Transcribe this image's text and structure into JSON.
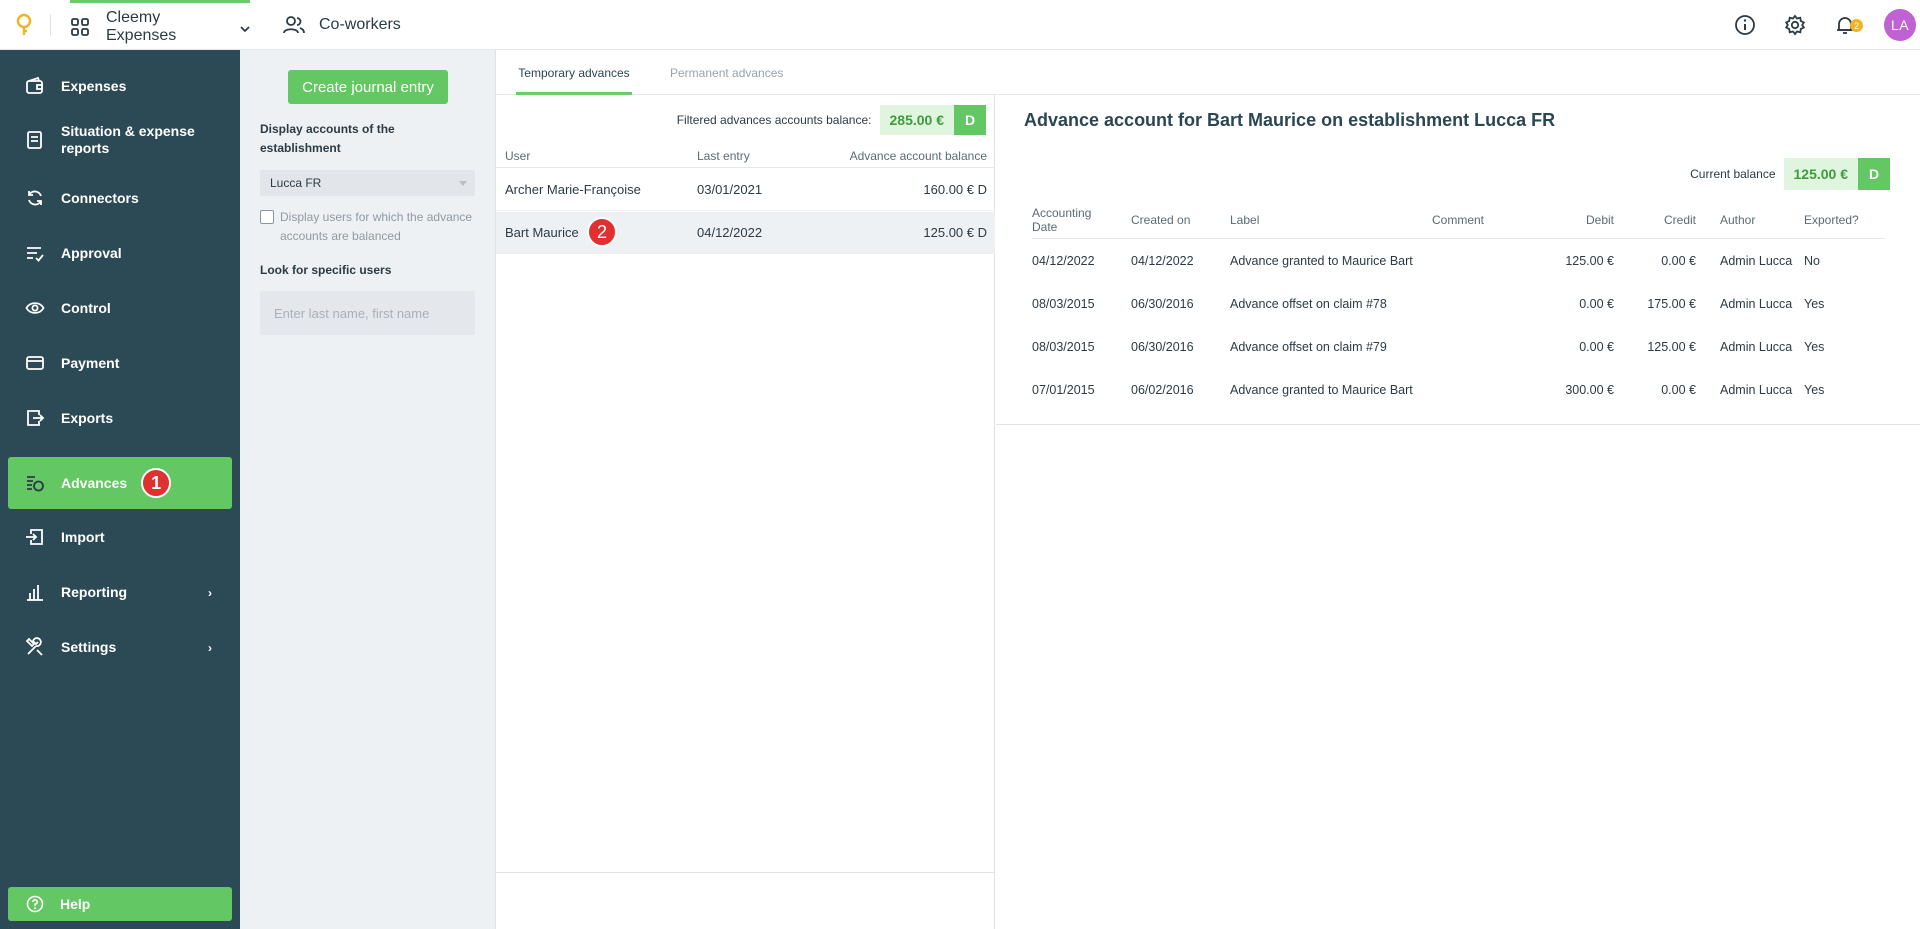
{
  "topbar": {
    "app_name": "Cleemy Expenses",
    "coworkers_label": "Co-workers",
    "notification_count": "2",
    "avatar_initials": "LA"
  },
  "sidebar": {
    "items": [
      {
        "label": "Expenses",
        "icon": "wallet-icon"
      },
      {
        "label": "Situation & expense reports",
        "icon": "document-icon"
      },
      {
        "label": "Connectors",
        "icon": "sync-icon"
      },
      {
        "label": "Approval",
        "icon": "checklist-icon"
      },
      {
        "label": "Control",
        "icon": "eye-icon"
      },
      {
        "label": "Payment",
        "icon": "card-icon"
      },
      {
        "label": "Exports",
        "icon": "export-icon"
      },
      {
        "label": "Advances",
        "icon": "coins-icon"
      },
      {
        "label": "Import",
        "icon": "import-icon"
      },
      {
        "label": "Reporting",
        "icon": "bar-chart-icon"
      },
      {
        "label": "Settings",
        "icon": "tools-icon"
      }
    ],
    "active_item": "Advances",
    "help_label": "Help",
    "marker_1": "1"
  },
  "filters": {
    "create_button": "Create journal entry",
    "establishment_label": "Display accounts of the establishment",
    "establishment_value": "Lucca FR",
    "balanced_checkbox_label": "Display users for which the advance accounts are balanced",
    "search_label": "Look for specific users",
    "search_placeholder": "Enter last name, first name"
  },
  "tabs": [
    {
      "label": "Temporary advances",
      "active": true
    },
    {
      "label": "Permanent advances",
      "active": false
    }
  ],
  "list": {
    "balance_label": "Filtered advances accounts balance:",
    "balance_amount": "285.00 €",
    "balance_side": "D",
    "headers": {
      "user": "User",
      "last_entry": "Last entry",
      "balance": "Advance account balance"
    },
    "rows": [
      {
        "user": "Archer Marie-Françoise",
        "last_entry": "03/01/2021",
        "balance": "160.00 € D"
      },
      {
        "user": "Bart Maurice",
        "last_entry": "04/12/2022",
        "balance": "125.00 € D"
      }
    ],
    "marker_2": "2"
  },
  "detail": {
    "title": "Advance account for Bart Maurice on establishment Lucca FR",
    "current_balance_label": "Current balance",
    "current_balance_amount": "125.00 €",
    "current_balance_side": "D",
    "headers": {
      "accounting_date_1": "Accounting",
      "accounting_date_2": "Date",
      "created_on": "Created on",
      "label": "Label",
      "comment": "Comment",
      "debit": "Debit",
      "credit": "Credit",
      "author": "Author",
      "exported": "Exported?"
    },
    "rows": [
      {
        "accounting_date": "04/12/2022",
        "created_on": "04/12/2022",
        "label": "Advance granted to Maurice Bart",
        "comment": "",
        "debit": "125.00 €",
        "credit": "0.00 €",
        "author": "Admin Lucca",
        "exported": "No"
      },
      {
        "accounting_date": "08/03/2015",
        "created_on": "06/30/2016",
        "label": "Advance offset on claim #78",
        "comment": "",
        "debit": "0.00 €",
        "credit": "175.00 €",
        "author": "Admin Lucca",
        "exported": "Yes"
      },
      {
        "accounting_date": "08/03/2015",
        "created_on": "06/30/2016",
        "label": "Advance offset on claim #79",
        "comment": "",
        "debit": "0.00 €",
        "credit": "125.00 €",
        "author": "Admin Lucca",
        "exported": "Yes"
      },
      {
        "accounting_date": "07/01/2015",
        "created_on": "06/02/2016",
        "label": "Advance granted to Maurice Bart",
        "comment": "",
        "debit": "300.00 €",
        "credit": "0.00 €",
        "author": "Admin Lucca",
        "exported": "Yes"
      }
    ]
  },
  "colors": {
    "sidebar_bg": "#2c4a55",
    "accent_green": "#63c763",
    "marker_red": "#e03131",
    "avatar_purple": "#c061d4",
    "logo_yellow": "#f0b429"
  }
}
